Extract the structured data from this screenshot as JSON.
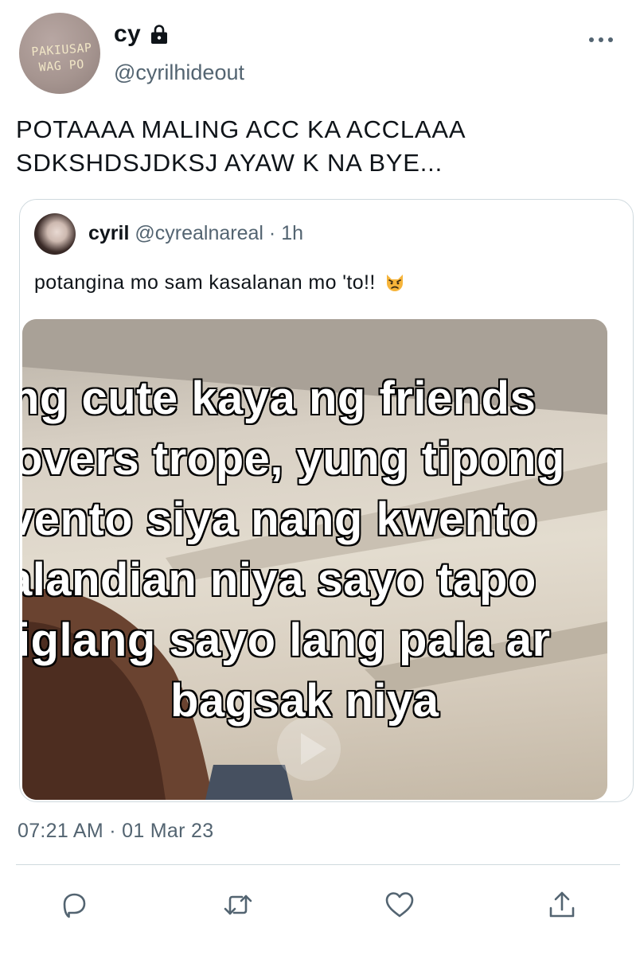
{
  "tweet": {
    "author": {
      "display_name": "cy",
      "handle": "@cyrilhideout",
      "protected_icon": "lock-icon",
      "avatar_text": [
        "PAKIUSAP",
        "WAG PO"
      ]
    },
    "text": "POTAAAA MALING ACC KA ACCLAAA SDKSHDSJDKSJ AYAW K NA BYE...",
    "timestamp": "07:21 AM · 01 Mar 23",
    "more_icon": "more-icon"
  },
  "quote": {
    "name": "cyril",
    "handle": "@cyrealnareal",
    "separator": "·",
    "time": "1h",
    "text": "potangina mo sam kasalanan mo 'to!!",
    "emoji_icon": "pouting-cat-emoji-icon",
    "media": {
      "caption_lines": [
        "ng cute kaya ng friends",
        "overs trope, yung tipong",
        "vento siya nang kwento",
        "alandian niya sayo tapo",
        "iglang sayo lang pala ar",
        "bagsak niya"
      ]
    }
  },
  "actions": [
    {
      "name": "reply",
      "icon": "reply-icon"
    },
    {
      "name": "retweet",
      "icon": "retweet-icon"
    },
    {
      "name": "like",
      "icon": "heart-icon"
    },
    {
      "name": "share",
      "icon": "share-icon"
    }
  ],
  "colors": {
    "text_primary": "#0f1419",
    "text_secondary": "#536471",
    "border": "#cfd9de"
  }
}
